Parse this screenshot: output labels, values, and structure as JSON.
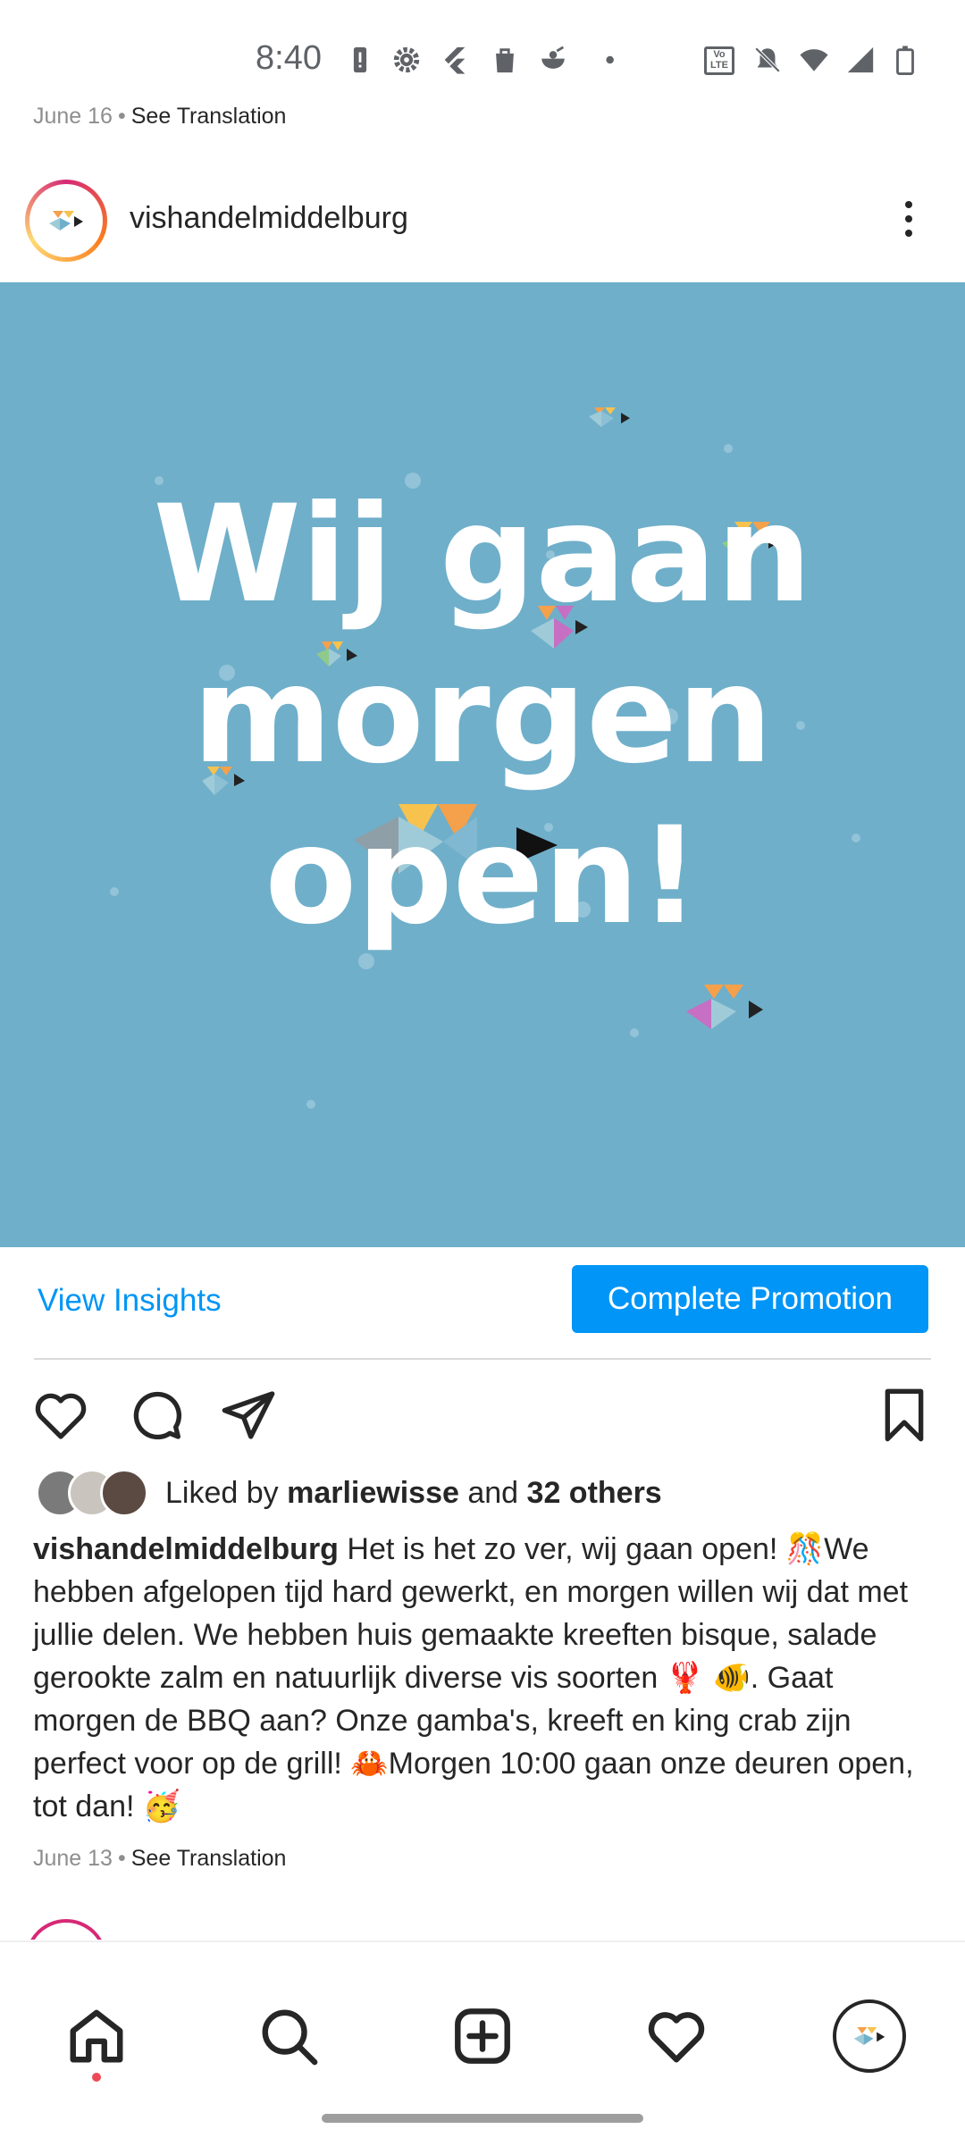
{
  "status_bar": {
    "time": "8:40",
    "network_label": "Vo LTE",
    "icons": [
      "alert-icon",
      "settings-icon",
      "flutter-icon",
      "shopping-bag-icon",
      "food-icon",
      "dot-icon",
      "volte-icon",
      "mute-icon",
      "wifi-icon",
      "signal-icon",
      "battery-icon"
    ]
  },
  "previous_post": {
    "date": "June 16",
    "separator": "•",
    "see_translation": "See Translation"
  },
  "post": {
    "username": "vishandelmiddelburg",
    "more_icon": "more-vertical-icon",
    "image": {
      "background_color": "#6fafca",
      "lines": [
        "Wij gaan",
        "morgen",
        "open!"
      ]
    },
    "view_insights": "View Insights",
    "complete_promotion": "Complete Promotion",
    "accent_color": "#0095f6",
    "actions": [
      "heart-icon",
      "comment-icon",
      "share-icon",
      "bookmark-icon"
    ],
    "likes": {
      "prefix": "Liked by",
      "user": "marliewisse",
      "middle": "and",
      "others": "32 others"
    },
    "caption": {
      "username": "vishandelmiddelburg",
      "text": "Het is het zo ver, wij gaan open! 🎊We hebben afgelopen tijd hard gewerkt, en morgen willen wij dat met jullie delen. We hebben huis gemaakte kreeften bisque, salade gerookte zalm en natuurlijk diverse vis soorten 🦞 🐠. Gaat morgen de BBQ aan? Onze gamba's, kreeft en king crab zijn perfect voor op de grill! 🦀Morgen 10:00 gaan onze deuren open, tot dan! 🥳"
    },
    "date": "June 13",
    "separator": "•",
    "see_translation": "See Translation"
  },
  "bottom_nav": [
    "home-icon",
    "search-icon",
    "create-icon",
    "activity-icon",
    "profile-icon"
  ]
}
